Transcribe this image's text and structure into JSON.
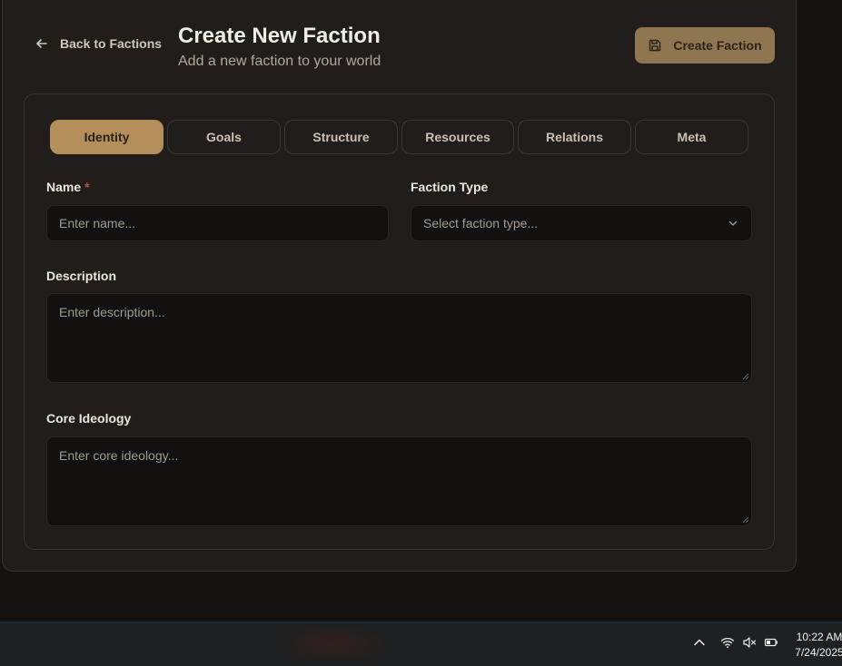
{
  "header": {
    "back_label": "Back to Factions",
    "title": "Create New Faction",
    "subtitle": "Add a new faction to your world",
    "create_label": "Create Faction"
  },
  "tabs": [
    {
      "label": "Identity",
      "active": true
    },
    {
      "label": "Goals",
      "active": false
    },
    {
      "label": "Structure",
      "active": false
    },
    {
      "label": "Resources",
      "active": false
    },
    {
      "label": "Relations",
      "active": false
    },
    {
      "label": "Meta",
      "active": false
    }
  ],
  "form": {
    "name": {
      "label": "Name",
      "required_mark": "*",
      "placeholder": "Enter name...",
      "value": ""
    },
    "faction_type": {
      "label": "Faction Type",
      "placeholder": "Select faction type..."
    },
    "description": {
      "label": "Description",
      "placeholder": "Enter description...",
      "value": ""
    },
    "core_ideology": {
      "label": "Core Ideology",
      "placeholder": "Enter core ideology...",
      "value": ""
    }
  },
  "taskbar": {
    "time": "10:22 AM",
    "date": "7/24/2025",
    "icons": [
      "chevron-up-icon",
      "wifi-icon",
      "volume-muted-icon",
      "battery-icon"
    ]
  },
  "colors": {
    "accent": "#b48f5b",
    "button": "#8f7651",
    "background": "#151311",
    "panel": "#201d1a",
    "required": "#c0523f"
  }
}
